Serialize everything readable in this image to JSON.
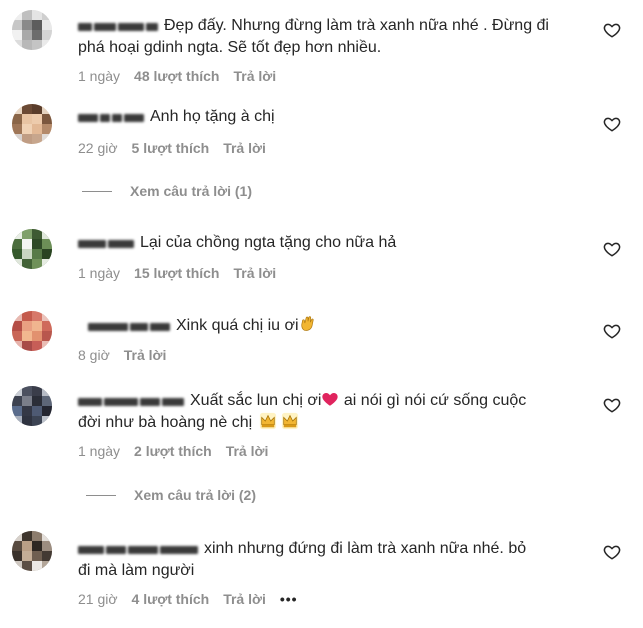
{
  "colors": {
    "text": "#262626",
    "meta": "#8e8e8e",
    "heart_stroke": "#262626",
    "emoji_red_heart": "#e0245e",
    "emoji_gold": "#f2b632"
  },
  "comments": [
    {
      "text": "Đẹp đấy. Nhưng đừng làm trà xanh nữa nhé . Đừng đi",
      "text2": "phá hoại gdinh ngta. Sẽ tốt đẹp hơn nhiều.",
      "time": "1 ngày",
      "likes": "48 lượt thích",
      "reply": "Trả lời"
    },
    {
      "text": "Anh họ tặng à chị",
      "time": "22 giờ",
      "likes": "5 lượt thích",
      "reply": "Trả lời",
      "view_replies": "Xem câu trả lời (1)"
    },
    {
      "text": "Lại của chồng ngta tặng cho nữa hả",
      "time": "1 ngày",
      "likes": "15 lượt thích",
      "reply": "Trả lời"
    },
    {
      "text": "Xink quá chị iu ơi",
      "time": "8 giờ",
      "reply": "Trả lời"
    },
    {
      "text": "Xuất sắc lun chị ơi",
      "text_after_heart": " ai nói gì nói cứ sống cuộc",
      "text2": "đời như bà hoàng nè chị",
      "time": "1 ngày",
      "likes": "2 lượt thích",
      "reply": "Trả lời",
      "view_replies": "Xem câu trả lời (2)"
    },
    {
      "text": "xinh nhưng đứng đi làm trà xanh nữa nhé. bỏ",
      "text2": "đi mà làm người",
      "time": "21 giờ",
      "likes": "4 lượt thích",
      "reply": "Trả lời",
      "more": "•••"
    }
  ],
  "icons": {
    "like": "heart-outline-icon",
    "clap": "clapping-hands-emoji",
    "red_heart": "red-heart-emoji",
    "crown": "crown-emoji"
  }
}
